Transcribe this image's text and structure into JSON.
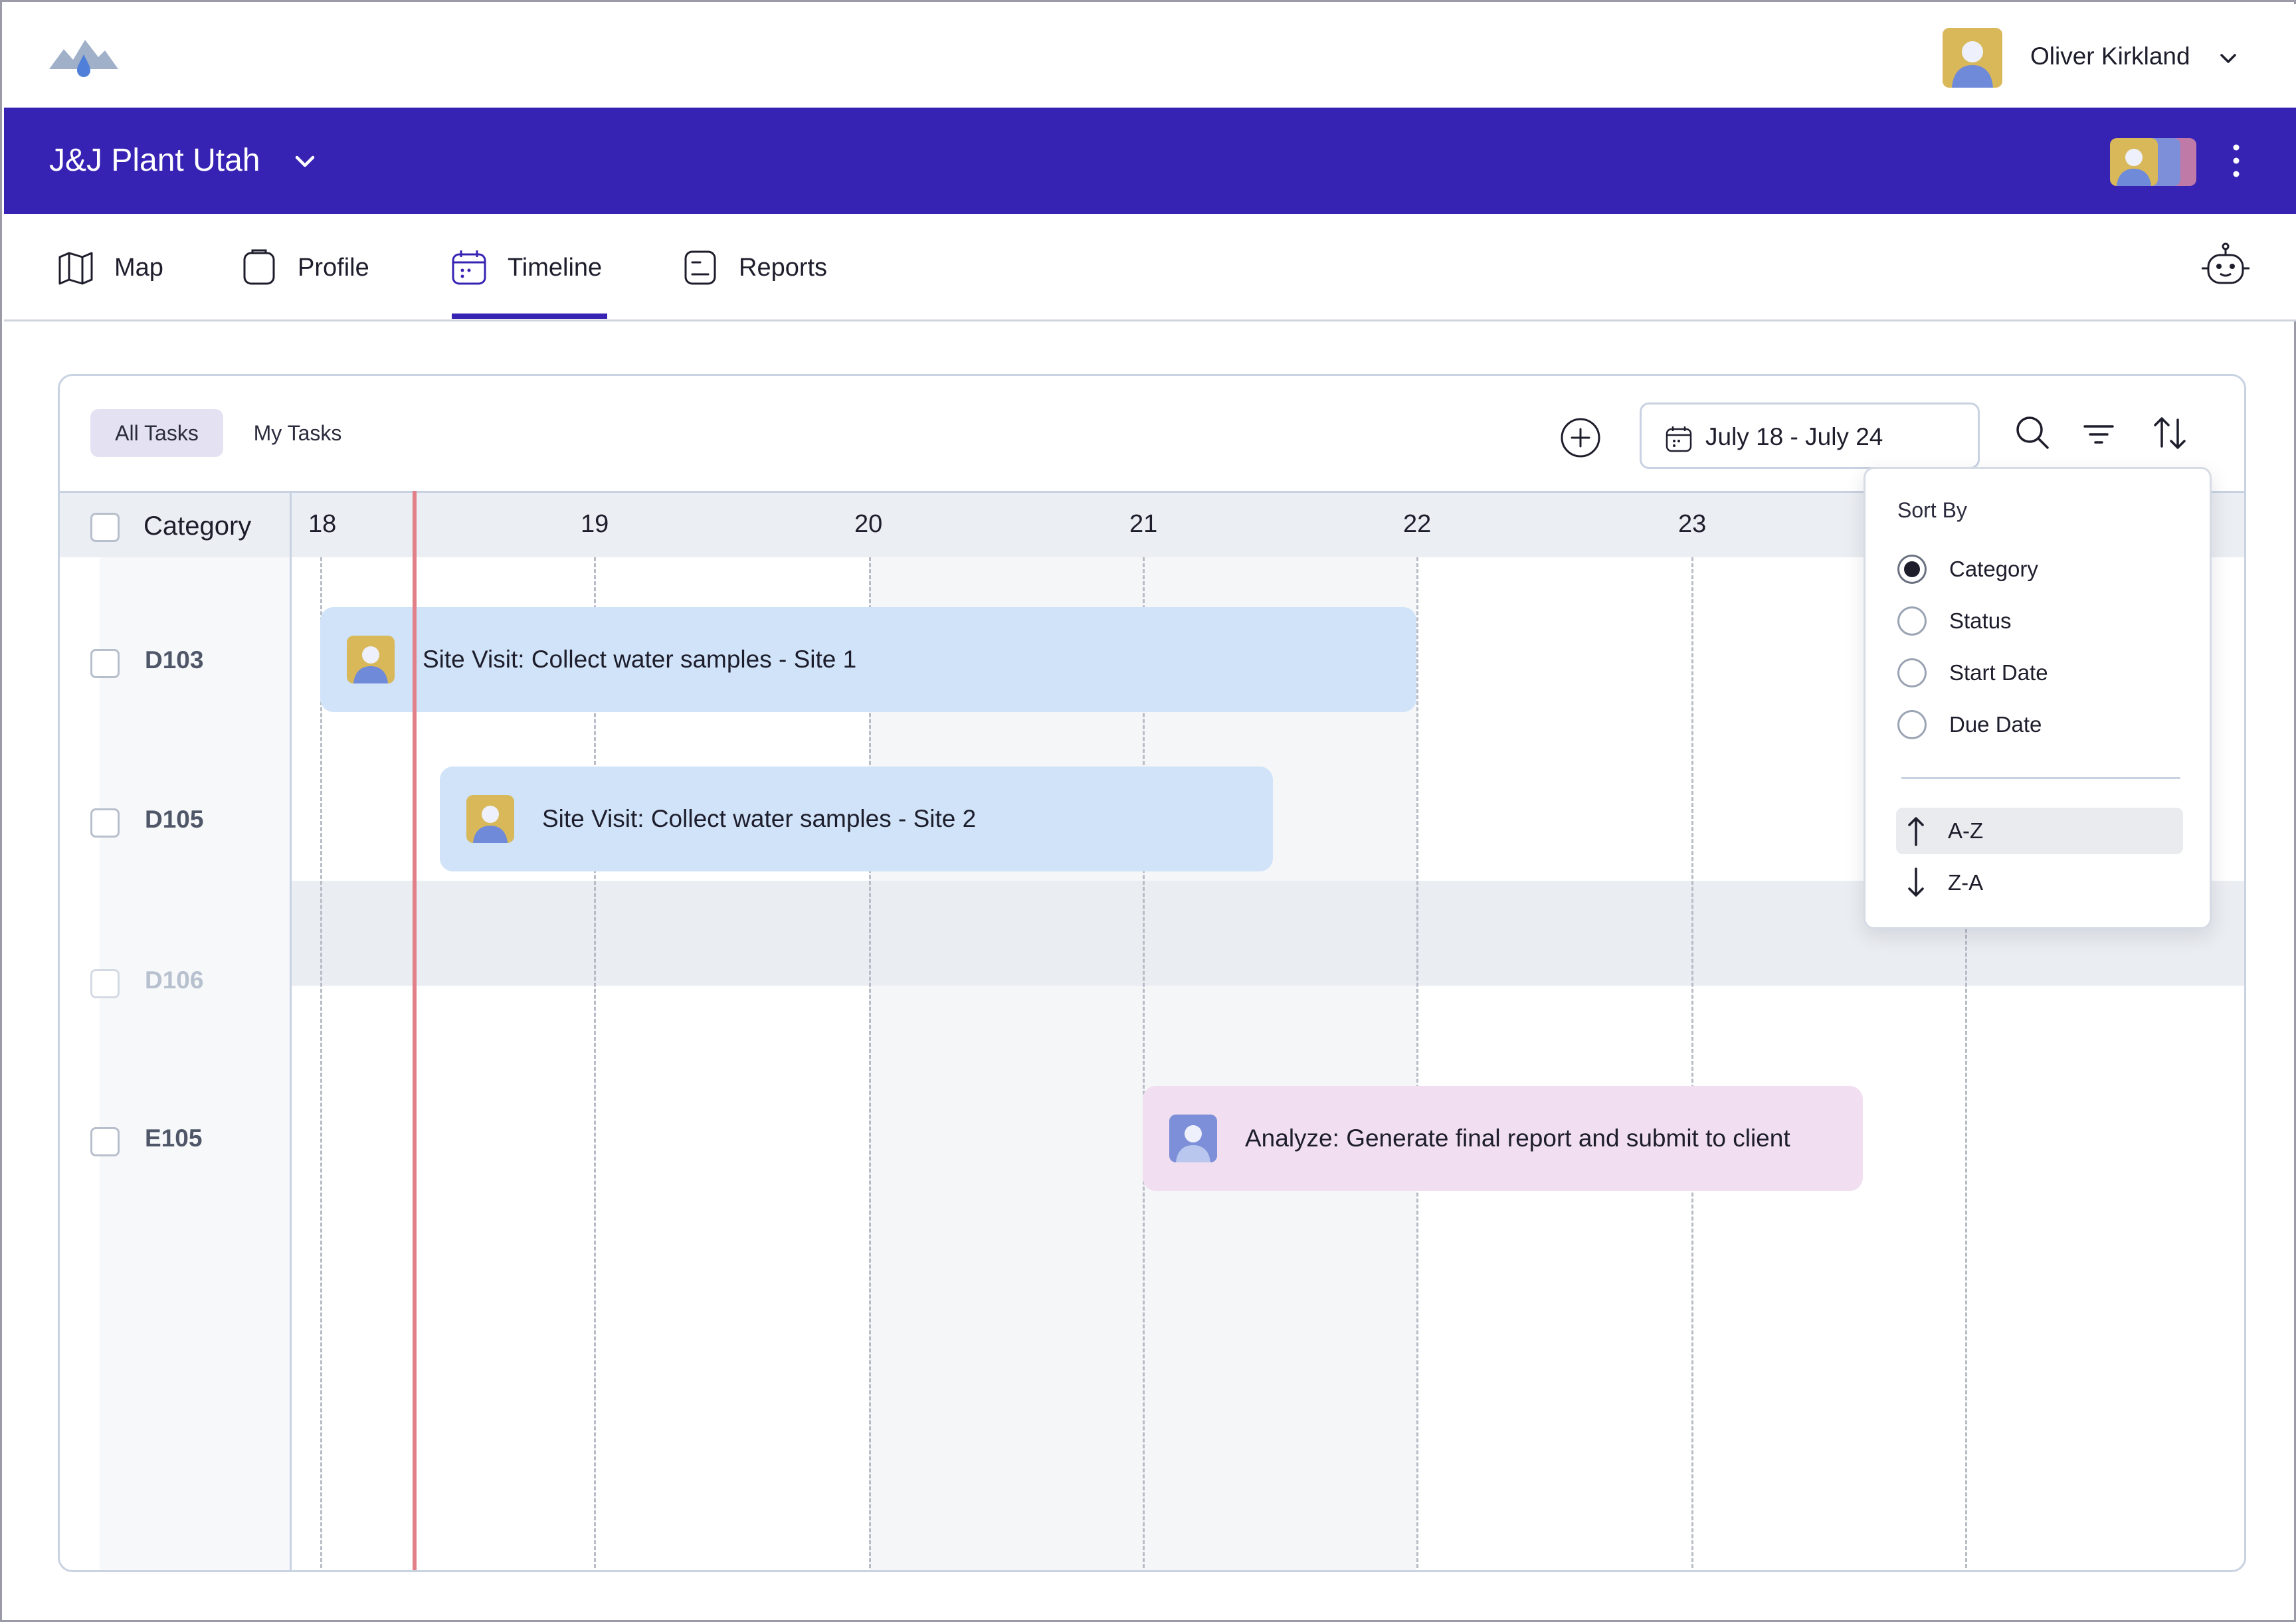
{
  "header": {
    "user_name": "Oliver Kirkland",
    "logo_icon": "mountain-drop-logo",
    "avatar_color": "#d9b85a"
  },
  "project": {
    "name": "J&J Plant Utah",
    "bar_color": "#3623b3"
  },
  "nav": {
    "tabs": [
      {
        "label": "Map",
        "icon": "map-icon",
        "active": false
      },
      {
        "label": "Profile",
        "icon": "profile-icon",
        "active": false
      },
      {
        "label": "Timeline",
        "icon": "calendar-icon",
        "active": true
      },
      {
        "label": "Reports",
        "icon": "report-icon",
        "active": false
      }
    ],
    "assistant_icon": "robot-icon"
  },
  "toolbar": {
    "all_tasks": "All Tasks",
    "my_tasks": "My Tasks",
    "date_range": "July 18 - July 24"
  },
  "timeline": {
    "category_header": "Category",
    "days": [
      "18",
      "19",
      "20",
      "21",
      "22",
      "23"
    ],
    "rows": [
      {
        "label": "D103",
        "disabled": false
      },
      {
        "label": "D105",
        "disabled": false
      },
      {
        "label": "D106",
        "disabled": true
      },
      {
        "label": "E105",
        "disabled": false
      }
    ],
    "tasks": [
      {
        "title": "Site Visit: Collect water samples - Site 1",
        "color": "#d0e3f8",
        "avatar_color": "#d9b85a"
      },
      {
        "title": "Site Visit: Collect water samples - Site 2",
        "color": "#d0e3f8",
        "avatar_color": "#d9b85a"
      },
      {
        "title": "Analyze: Generate final report and submit to client",
        "color": "#f1dff1",
        "avatar_color": "#7c8fd8"
      }
    ]
  },
  "sort_popover": {
    "title": "Sort By",
    "options": [
      "Category",
      "Status",
      "Start Date",
      "Due Date"
    ],
    "selected": "Category",
    "directions": [
      "A-Z",
      "Z-A"
    ],
    "selected_direction": "A-Z"
  }
}
